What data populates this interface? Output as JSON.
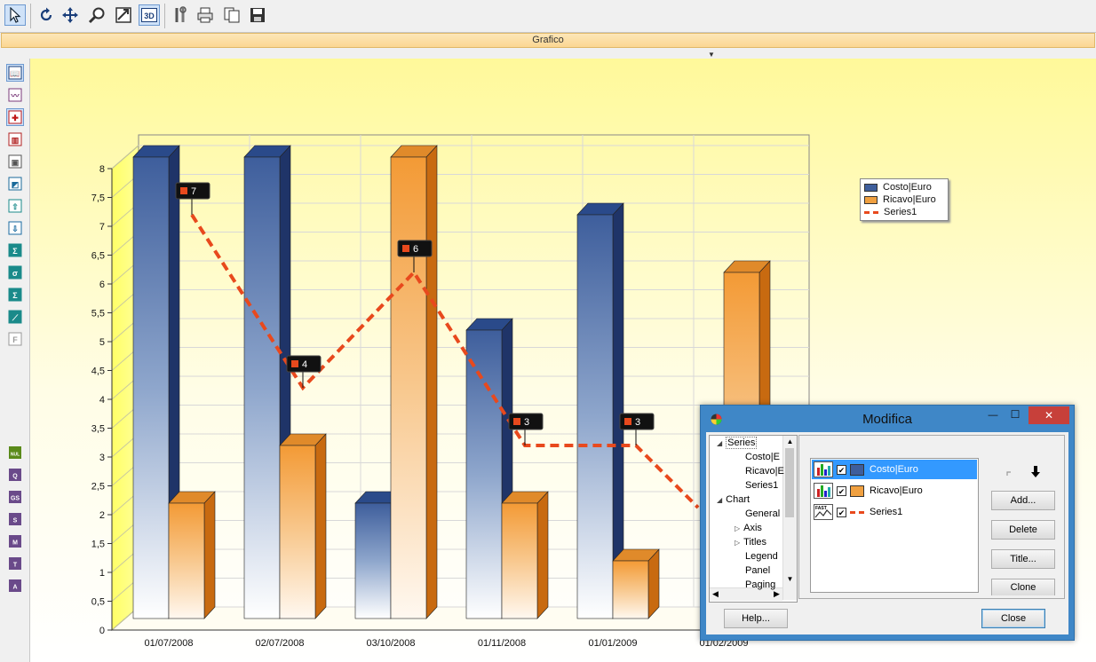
{
  "toolbar": {
    "buttons": [
      "select-arrow-icon",
      "undo-rotate-icon",
      "move-icon",
      "zoom-icon",
      "export-image-icon",
      "active-3d-icon",
      "tools-icon",
      "print-icon",
      "copy-icon",
      "save-icon"
    ]
  },
  "window": {
    "title": "Grafico"
  },
  "left_toolbar": {
    "top_icons": [
      "gallery-icon",
      "series-edit-icon",
      "crosshair-icon",
      "bar-series-icon",
      "camera-icon",
      "import-icon",
      "sort-up-icon",
      "sort-down-icon",
      "function-icon",
      "sigma-small-icon",
      "sigma-icon",
      "trend-icon",
      "formula-icon"
    ],
    "bottom_icons": [
      "nul-icon",
      "gq-icon",
      "gs-icon",
      "gx-icon",
      "gm-icon",
      "gt-icon",
      "gz-icon"
    ],
    "bottom_labels": [
      "NUL",
      "Q",
      "GS",
      "S",
      "M",
      "T",
      "A"
    ]
  },
  "chart_data": {
    "type": "bar",
    "categories": [
      "01/07/2008",
      "02/07/2008",
      "03/10/2008",
      "01/11/2008",
      "01/01/2009",
      "01/02/2009"
    ],
    "series": [
      {
        "name": "Costo|Euro",
        "type": "bar",
        "color": "#3e5e9c",
        "values": [
          8,
          8,
          2,
          5,
          7,
          null
        ]
      },
      {
        "name": "Ricavo|Euro",
        "type": "bar",
        "color": "#f0a040",
        "values": [
          2,
          3,
          8,
          2,
          1,
          6
        ]
      },
      {
        "name": "Series1",
        "type": "line",
        "color": "#e8491d",
        "style": "dashed",
        "values": [
          7,
          4,
          6,
          3,
          3,
          null
        ],
        "labels": [
          "7",
          "4",
          "6",
          "3",
          "3"
        ]
      }
    ],
    "yticks": [
      "0",
      "0,5",
      "1",
      "1,5",
      "2",
      "2,5",
      "3",
      "3,5",
      "4",
      "4,5",
      "5",
      "5,5",
      "6",
      "6,5",
      "7",
      "7,5",
      "8"
    ],
    "ylim": [
      0,
      8
    ],
    "grid": true,
    "legend_position": "top-right"
  },
  "dialog": {
    "title": "Modifica",
    "tree": [
      {
        "label": "Series",
        "expander": "◢"
      },
      {
        "label": "Costo|E"
      },
      {
        "label": "Ricavo|E"
      },
      {
        "label": "Series1"
      },
      {
        "label": "Chart",
        "expander": "◢"
      },
      {
        "label": "General"
      },
      {
        "label": "Axis",
        "expander": "▷"
      },
      {
        "label": "Titles",
        "expander": "▷"
      },
      {
        "label": "Legend"
      },
      {
        "label": "Panel"
      },
      {
        "label": "Paging"
      }
    ],
    "series_list": [
      {
        "label": "Costo|Euro",
        "checked": "✔",
        "selected": true,
        "color": "#3e5e9c"
      },
      {
        "label": "Ricavo|Euro",
        "checked": "✔",
        "selected": false,
        "color": "#f0a040"
      },
      {
        "label": "Series1",
        "checked": "✔",
        "selected": false,
        "color": "#e8491d"
      }
    ],
    "buttons": {
      "add": "Add...",
      "delete": "Delete",
      "title": "Title...",
      "clone": "Clone",
      "help": "Help...",
      "close": "Close"
    },
    "window_controls": {
      "minimize": "—",
      "maximize": "☐",
      "close": "✕"
    }
  }
}
